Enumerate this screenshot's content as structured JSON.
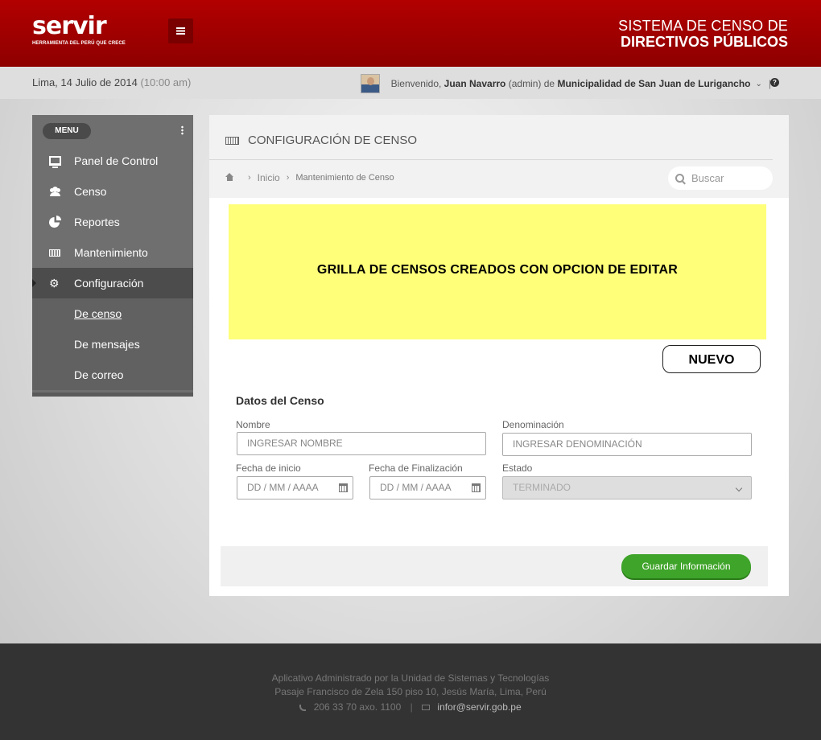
{
  "header": {
    "logo_text": "servir",
    "logo_tagline": "HERRAMIENTA DEL PERÚ QUE CRECE",
    "system_title_line1": "SISTEMA DE CENSO  DE",
    "system_title_line2": "DIRECTIVOS PÚBLICOS",
    "brand_color": "#a30000"
  },
  "infobar": {
    "date": "Lima, 14 Julio de 2014",
    "time": "(10:00 am)",
    "welcome": "Bienvenido,",
    "user_name": "Juan Navarro",
    "user_role": "(admin)",
    "de": "de",
    "organization": "Municipalidad de San Juan de Lurigancho",
    "sep": "|",
    "help": "?"
  },
  "sidebar": {
    "menu_label": "MENU",
    "items": [
      {
        "label": "Panel de Control",
        "icon": "monitor-icon"
      },
      {
        "label": "Censo",
        "icon": "users-icon"
      },
      {
        "label": "Reportes",
        "icon": "pie-chart-icon"
      },
      {
        "label": "Mantenimiento",
        "icon": "keyboard-icon"
      },
      {
        "label": "Configuración",
        "icon": "cogs-icon",
        "active": true
      }
    ],
    "sub_items": [
      {
        "label": "De censo",
        "current": true
      },
      {
        "label": "De mensajes"
      },
      {
        "label": "De correo"
      }
    ]
  },
  "panel": {
    "title": "CONFIGURACIÓN DE CENSO",
    "breadcrumb": {
      "home": "Inicio",
      "current": "Mantenimiento de Censo"
    },
    "search_placeholder": "Buscar",
    "grid_placeholder": "GRILLA DE CENSOS CREADOS CON OPCION DE EDITAR",
    "new_button": "NUEVO",
    "form": {
      "title": "Datos del Censo",
      "nombre_label": "Nombre",
      "nombre_placeholder": "INGRESAR NOMBRE",
      "denominacion_label": "Denominación",
      "denominacion_placeholder": "INGRESAR DENOMINACIÓN",
      "fecha_inicio_label": "Fecha de inicio",
      "fecha_inicio_placeholder": "DD / MM / AAAA",
      "fecha_fin_label": "Fecha de Finalización",
      "fecha_fin_placeholder": "DD / MM / AAAA",
      "estado_label": "Estado",
      "estado_value": "TERMINADO"
    },
    "save_button": "Guardar Información",
    "save_color": "#3fa42a"
  },
  "footer": {
    "line1": "Aplicativo Administrado por la Unidad de Sistemas y Tecnologías",
    "line2": "Pasaje Francisco de Zela 150 piso 10, Jesús María, Lima, Perú",
    "phone": "206 33 70 axo. 1100",
    "sep": "|",
    "email": "infor@servir.gob.pe"
  }
}
